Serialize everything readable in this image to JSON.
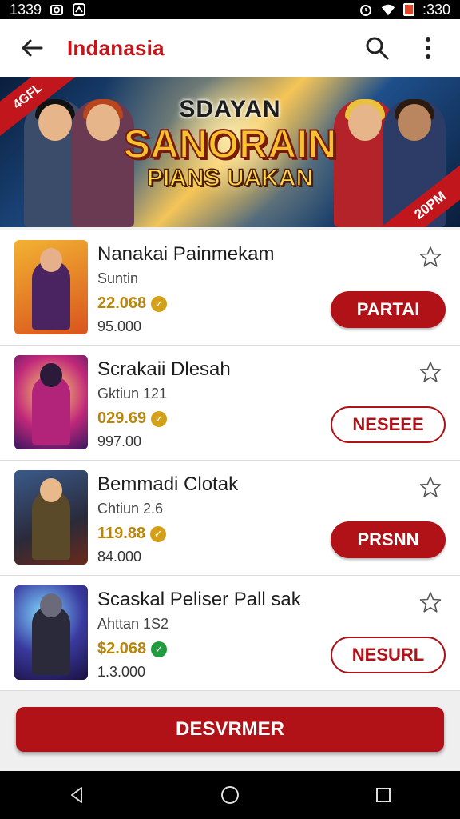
{
  "status_bar": {
    "time": "1339",
    "battery_text": ":330",
    "icons": [
      "camera-icon",
      "sync-icon",
      "alarm-icon",
      "wifi-icon",
      "battery-icon"
    ]
  },
  "app_bar": {
    "title": "Indanasia",
    "icons": [
      "back-arrow-icon",
      "search-icon",
      "more-vert-icon"
    ],
    "brand_color": "#c0161c"
  },
  "banner": {
    "ribbon_left": "4GFL",
    "title_small": "SDAYAN",
    "title_big": "SANORAIN",
    "title_sub": "PIANS UAKAN",
    "ribbon_right": "20PM"
  },
  "items": [
    {
      "title": "Nanakai Painmekam",
      "subtitle": "Suntin",
      "price": "22.068",
      "price_icon": "coin-icon",
      "count": "95.000",
      "button": "PARTAI",
      "button_style": "filled",
      "fav_icon": "star-outline-icon"
    },
    {
      "title": "Scrakaii Dlesah",
      "subtitle": "Gktiun 121",
      "price": "029.69",
      "price_icon": "coin-icon",
      "count": "997.00",
      "button": "NESEEE",
      "button_style": "outline",
      "fav_icon": "star-outline-icon"
    },
    {
      "title": "Bemmadi Clotak",
      "subtitle": "Chtiun 2.6",
      "price": "119.88",
      "price_icon": "coin-icon",
      "count": "84.000",
      "button": "PRSNN",
      "button_style": "filled",
      "fav_icon": "star-outline-icon"
    },
    {
      "title": "Scaskal Peliser Pall sak",
      "subtitle": "Ahttan 1S2",
      "price": "$2.068",
      "price_icon": "check-badge-icon",
      "count": "1.3.000",
      "button": "NESURL",
      "button_style": "outline",
      "fav_icon": "star-outline-icon"
    }
  ],
  "primary_action": {
    "label": "DESVRMER"
  },
  "nav_bar": {
    "icons": [
      "back-triangle-icon",
      "home-circle-icon",
      "recents-square-icon"
    ]
  },
  "colors": {
    "accent": "#b01218",
    "gold": "#b8860b",
    "green_badge": "#1f9d3c"
  }
}
